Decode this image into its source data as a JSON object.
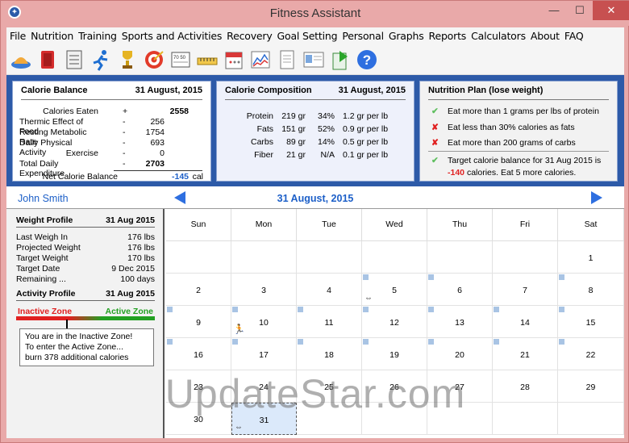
{
  "window": {
    "title": "Fitness Assistant",
    "minimize_label": "—",
    "maximize_label": "☐",
    "close_label": "✕"
  },
  "menu": [
    "File",
    "Nutrition",
    "Training",
    "Sports and Activities",
    "Recovery",
    "Goal Setting",
    "Personal",
    "Graphs",
    "Reports",
    "Calculators",
    "About",
    "FAQ"
  ],
  "toolbar_icons": [
    "meal-icon",
    "food-icon",
    "workout-icon",
    "runner-icon",
    "trophy-icon",
    "target-icon",
    "calculator-icon",
    "tape-measure-icon",
    "calendar-icon",
    "chart-icon",
    "document-icon",
    "report-icon",
    "export-icon",
    "help-icon"
  ],
  "calorie_balance": {
    "title": "Calorie Balance",
    "date": "31 August, 2015",
    "rows": [
      {
        "label": "Calories Eaten",
        "sign": "+",
        "value": "2558"
      },
      {
        "label": "Thermic Effect of Food",
        "sign": "-",
        "value": "256"
      },
      {
        "label": "Resting Metabolic Rate",
        "sign": "-",
        "value": "1754"
      },
      {
        "label": "Daily Physical Activity",
        "sign": "-",
        "value": "693"
      },
      {
        "label": "Exercise",
        "sign": "-",
        "value": "0"
      },
      {
        "label": "Total Daily Expenditure",
        "sign": "-",
        "value": "2703"
      }
    ],
    "net_label": "Net Calorie Balance",
    "net_value": "-145",
    "net_unit": "cal"
  },
  "calorie_composition": {
    "title": "Calorie Composition",
    "date": "31 August, 2015",
    "rows": [
      {
        "name": "Protein",
        "grams": "219 gr",
        "pct": "34%",
        "per_lb": "1.2 gr per lb"
      },
      {
        "name": "Fats",
        "grams": "151 gr",
        "pct": "52%",
        "per_lb": "0.9 gr per lb"
      },
      {
        "name": "Carbs",
        "grams": "89 gr",
        "pct": "14%",
        "per_lb": "0.5 gr per lb"
      },
      {
        "name": "Fiber",
        "grams": "21 gr",
        "pct": "N/A",
        "per_lb": "0.1 gr per lb"
      }
    ]
  },
  "nutrition_plan": {
    "title": "Nutrition Plan  (lose weight)",
    "items": [
      {
        "status": "ok",
        "text": "Eat more than 1 grams per lbs of protein"
      },
      {
        "status": "fail",
        "text": "Eat less than 30% calories as fats"
      },
      {
        "status": "fail",
        "text": "Eat more than 200 grams of carbs"
      }
    ],
    "target_line1": "Target calorie balance for 31 Aug 2015 is",
    "target_value": "-140",
    "target_line2": "calories. Eat 5 more calories."
  },
  "datebar": {
    "user": "John Smith",
    "date": "31 August, 2015"
  },
  "weight_profile": {
    "title": "Weight Profile",
    "date": "31 Aug 2015",
    "rows": [
      {
        "label": "Last Weigh In",
        "value": "176 lbs"
      },
      {
        "label": "Projected Weight",
        "value": "176 lbs"
      },
      {
        "label": "Target Weight",
        "value": "170 lbs"
      },
      {
        "label": "Target Date",
        "value": "9 Dec 2015"
      },
      {
        "label": "Remaining ...",
        "value": "100 days"
      }
    ]
  },
  "activity_profile": {
    "title": "Activity Profile",
    "date": "31 Aug 2015",
    "inactive_label": "Inactive Zone",
    "active_label": "Active Zone",
    "message": [
      "You are in the Inactive Zone!",
      "To enter the Active Zone...",
      "burn 378 additional calories"
    ]
  },
  "calendar": {
    "days": [
      "Sun",
      "Mon",
      "Tue",
      "Wed",
      "Thu",
      "Fri",
      "Sat"
    ],
    "weeks": [
      [
        "",
        "",
        "",
        "",
        "",
        "",
        "1"
      ],
      [
        "2",
        "3",
        "4",
        "5",
        "6",
        "7",
        "8"
      ],
      [
        "9",
        "10",
        "11",
        "12",
        "13",
        "14",
        "15"
      ],
      [
        "16",
        "17",
        "18",
        "19",
        "20",
        "21",
        "22"
      ],
      [
        "23",
        "24",
        "25",
        "26",
        "27",
        "28",
        "29"
      ],
      [
        "30",
        "31",
        "",
        "",
        "",
        "",
        ""
      ]
    ]
  },
  "watermark": "UpdateStar.com",
  "colors": {
    "accent_blue": "#2d5aa8",
    "date_blue": "#1c5fc8",
    "negative_red": "#e02020",
    "inactive_red": "#e02020",
    "active_green": "#22a022",
    "selected_cell": "#dbe9fa"
  }
}
